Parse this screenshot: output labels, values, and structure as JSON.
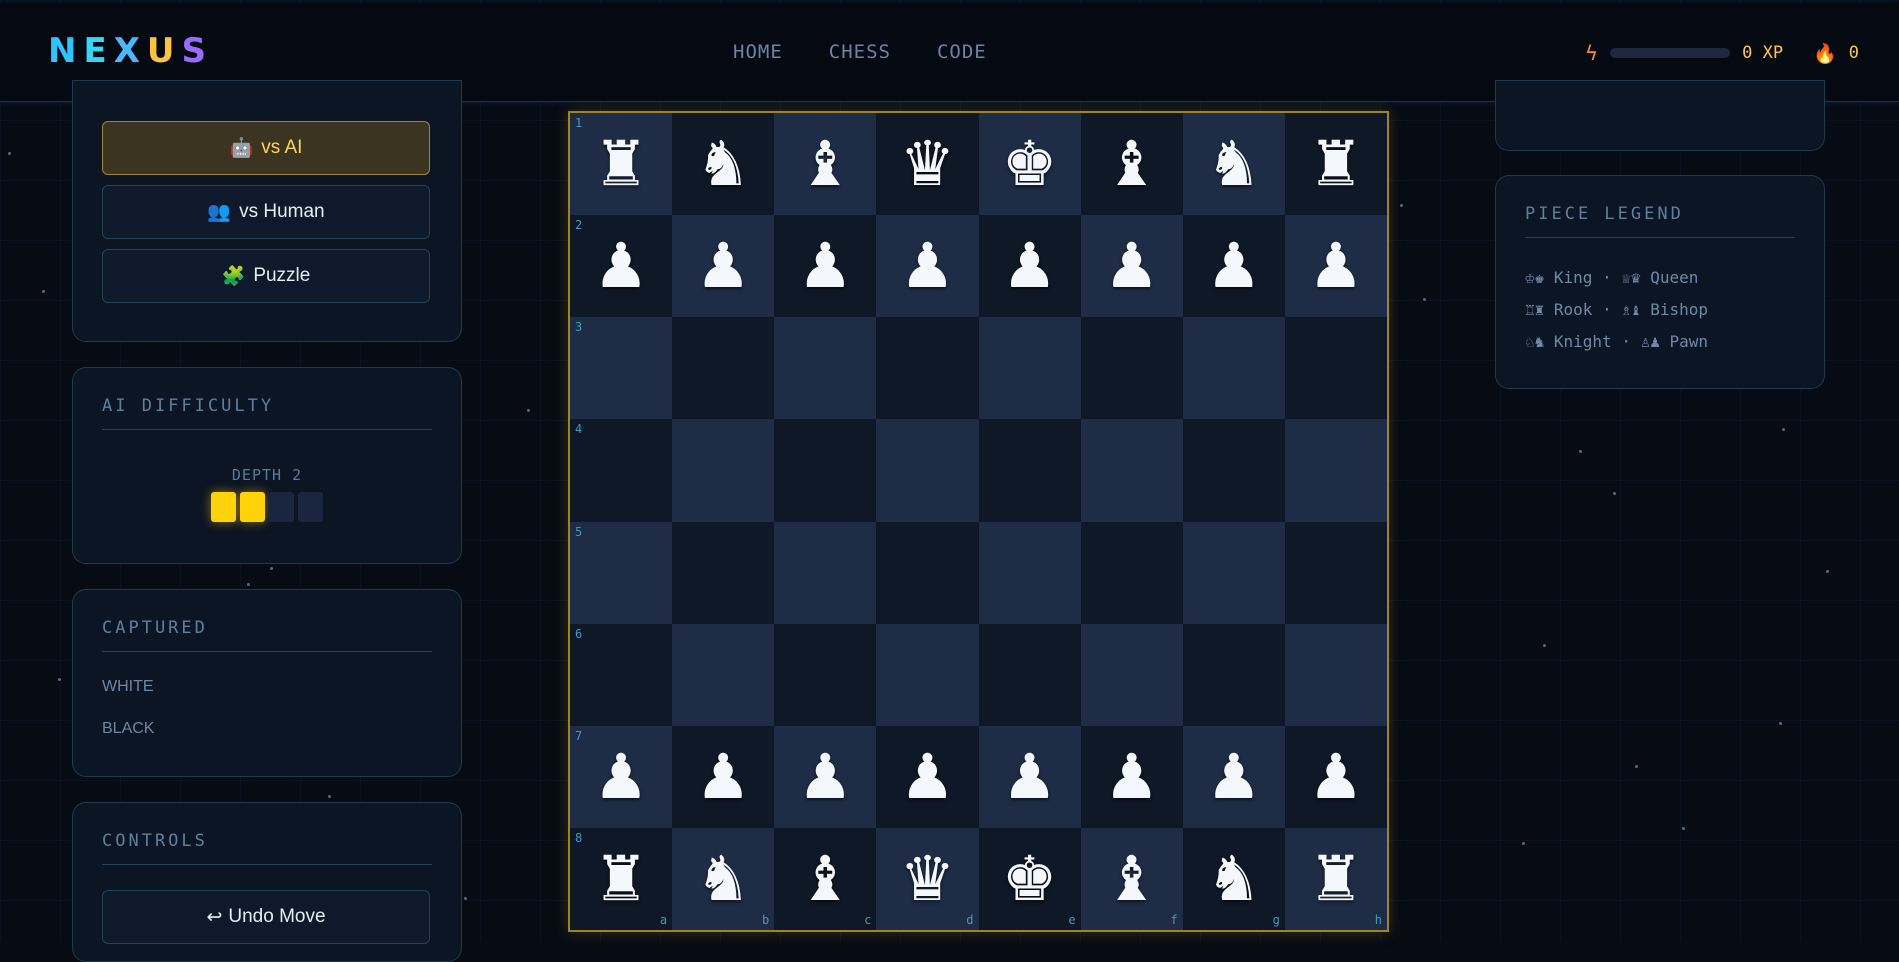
{
  "header": {
    "logo_letters": [
      "N",
      "E",
      "X",
      "U",
      "S"
    ],
    "nav": [
      "HOME",
      "CHESS",
      "CODE"
    ],
    "xp_icon": "lightning-icon",
    "xp_text": "0 XP",
    "xp_progress": 0,
    "streak_icon": "flame-icon",
    "streak_text": "0"
  },
  "mode_panel": {
    "buttons": [
      {
        "icon": "🤖",
        "label": "vs AI",
        "active": true
      },
      {
        "icon": "👥",
        "label": "vs Human",
        "active": false
      },
      {
        "icon": "🧩",
        "label": "Puzzle",
        "active": false
      }
    ]
  },
  "difficulty_panel": {
    "title": "AI DIFFICULTY",
    "depth_label": "DEPTH 2",
    "depth_level": 2,
    "depth_max": 4
  },
  "captured_panel": {
    "title": "CAPTURED",
    "white_label": "WHITE",
    "black_label": "BLACK"
  },
  "controls_panel": {
    "title": "CONTROLS",
    "undo_icon": "↩",
    "undo_label": "Undo Move"
  },
  "board": {
    "ranks": [
      "1",
      "2",
      "3",
      "4",
      "5",
      "6",
      "7",
      "8"
    ],
    "files": [
      "a",
      "b",
      "c",
      "d",
      "e",
      "f",
      "g",
      "h"
    ],
    "rows": [
      [
        "♜",
        "♞",
        "♝",
        "♛",
        "♚",
        "♝",
        "♞",
        "♜"
      ],
      [
        "♟",
        "♟",
        "♟",
        "♟",
        "♟",
        "♟",
        "♟",
        "♟"
      ],
      [
        "",
        "",
        "",
        "",
        "",
        "",
        "",
        ""
      ],
      [
        "",
        "",
        "",
        "",
        "",
        "",
        "",
        ""
      ],
      [
        "",
        "",
        "",
        "",
        "",
        "",
        "",
        ""
      ],
      [
        "",
        "",
        "",
        "",
        "",
        "",
        "",
        ""
      ],
      [
        "♟",
        "♟",
        "♟",
        "♟",
        "♟",
        "♟",
        "♟",
        "♟"
      ],
      [
        "♜",
        "♞",
        "♝",
        "♛",
        "♚",
        "♝",
        "♞",
        "♜"
      ]
    ]
  },
  "legend_panel": {
    "title": "PIECE LEGEND",
    "rows": [
      "♔♚ King · ♕♛ Queen",
      "♖♜ Rook · ♗♝ Bishop",
      "♘♞ Knight · ♙♟ Pawn"
    ]
  },
  "colors": {
    "accent_gold": "#ffd20a",
    "accent_cyan": "#3c9bc0",
    "background": "#070b14"
  }
}
